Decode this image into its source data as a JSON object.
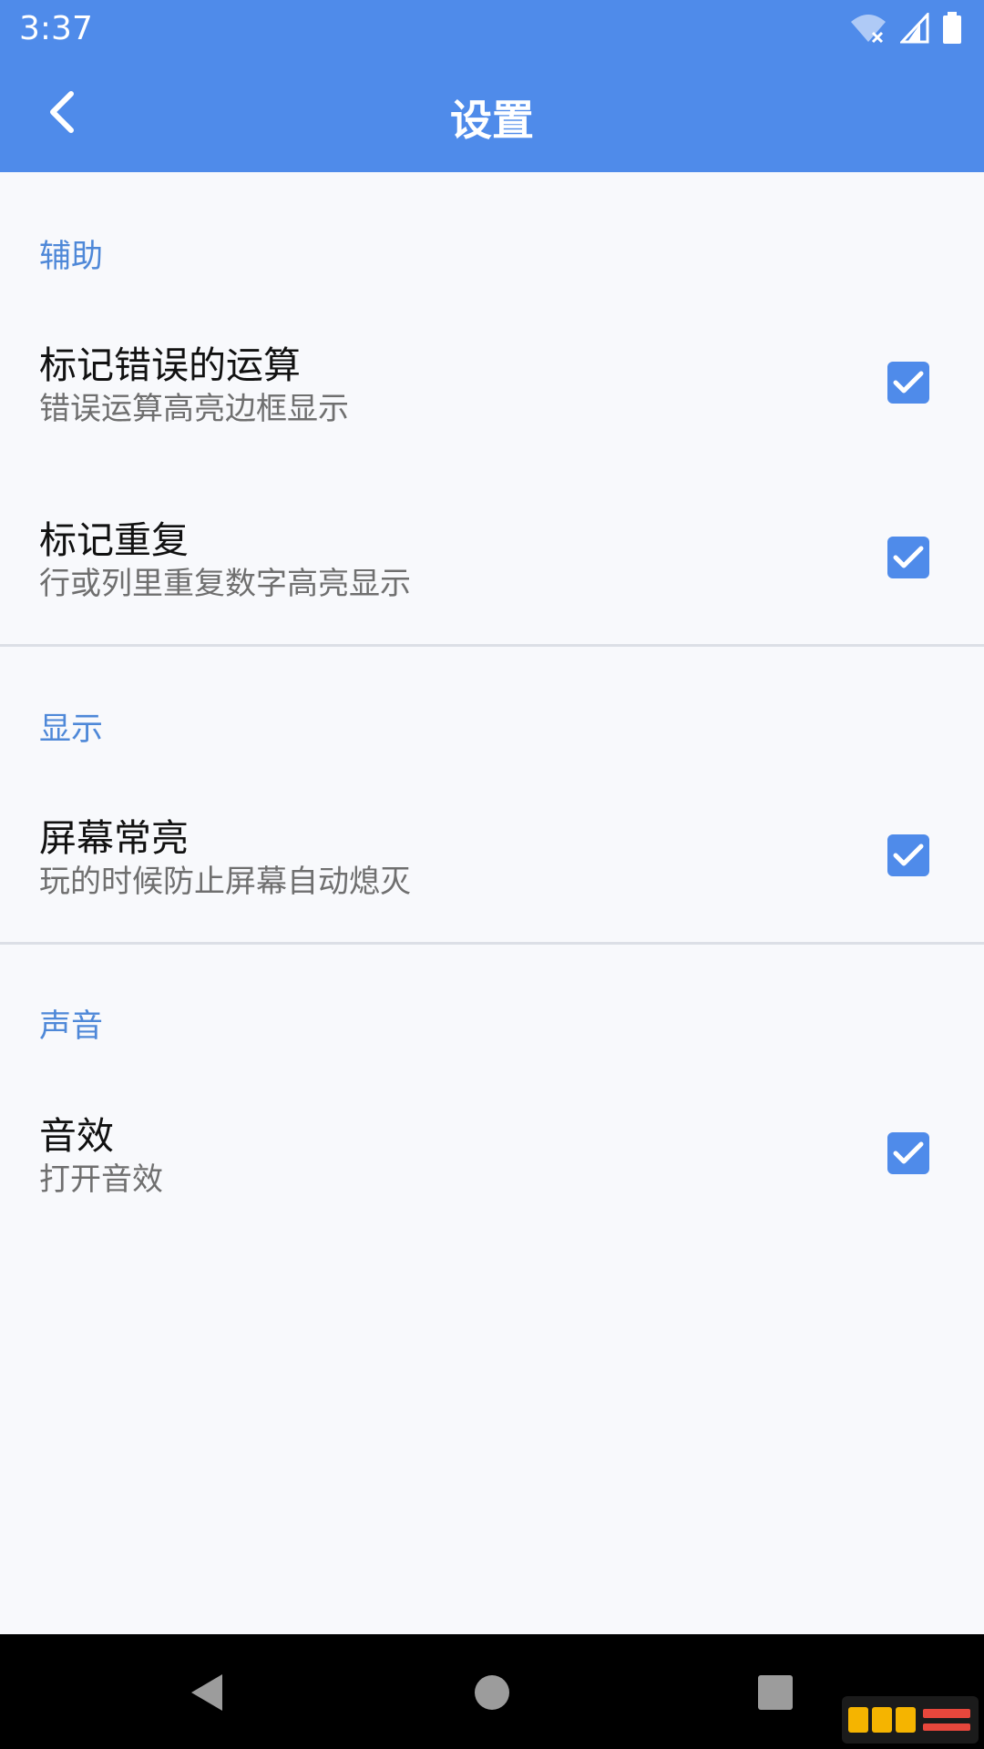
{
  "status_bar": {
    "time": "3:37"
  },
  "header": {
    "title": "设置"
  },
  "sections": [
    {
      "title": "辅助",
      "items": [
        {
          "title": "标记错误的运算",
          "subtitle": "错误运算高亮边框显示",
          "checked": true
        },
        {
          "title": "标记重复",
          "subtitle": "行或列里重复数字高亮显示",
          "checked": true
        }
      ]
    },
    {
      "title": "显示",
      "items": [
        {
          "title": "屏幕常亮",
          "subtitle": "玩的时候防止屏幕自动熄灭",
          "checked": true
        }
      ]
    },
    {
      "title": "声音",
      "items": [
        {
          "title": "音效",
          "subtitle": "打开音效",
          "checked": true
        }
      ]
    }
  ],
  "colors": {
    "accent": "#4F8BEA",
    "section_text": "#4E88D8",
    "background": "#F8F9FC"
  }
}
